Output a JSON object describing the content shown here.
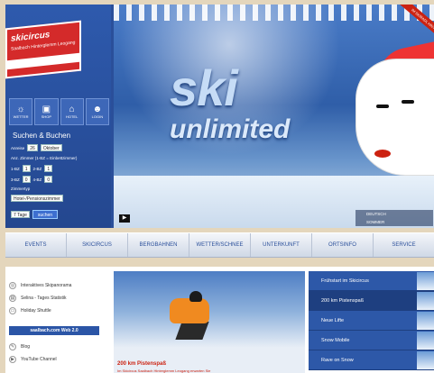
{
  "logo": {
    "name": "skicircus",
    "subtitle": "Saalbach Hinterglemm Leogang"
  },
  "nav_icons": [
    {
      "icon": "weather-icon",
      "label": "WETTER"
    },
    {
      "icon": "bag-icon",
      "label": "SHOP"
    },
    {
      "icon": "hotel-icon",
      "label": "HOTEL"
    },
    {
      "icon": "person-icon",
      "label": "LOGIN"
    }
  ],
  "search": {
    "title": "Suchen & Buchen",
    "arrival_label": "Anreise",
    "arrival_day": "26",
    "arrival_month": "Oktober",
    "rooms_label": "Anz. Zimmer (1-BZ = Einbettzimmer)",
    "room_1bz_label": "1-BZ",
    "room_1bz_value": "1",
    "room_2bz_label": "2-BZ",
    "room_2bz_value": "1",
    "room_3bz_label": "3-BZ",
    "room_3bz_value": "0",
    "room_4bz_label": "4-BZ",
    "room_4bz_value": "0",
    "category_label": "Zimmertyp",
    "category_value": "Hotel-/Pensionszimmer",
    "nights_value": "7 Tage",
    "submit_label": "suchen"
  },
  "hero": {
    "title": "ski",
    "subtitle": "unlimited",
    "badge": "IM SKIRADL HINTERGLEMM"
  },
  "languages": [
    "DEUTSCH",
    "SOMMER"
  ],
  "navbar": [
    "EVENTS",
    "SKICIRCUS",
    "BERGBAHNEN",
    "WETTER/SCHNEE",
    "UNTERKUNFT",
    "ORTSINFO",
    "SERVICE"
  ],
  "quicklinks": [
    {
      "icon": "panorama-icon",
      "label": "Interaktives Skipanorama"
    },
    {
      "icon": "ticket-icon",
      "label": "Selina - Tages Statistik"
    },
    {
      "icon": "shuttle-icon",
      "label": "Holiday Shuttle"
    }
  ],
  "web20_label": "saalbach.com Web 2.0",
  "quicklinks2": [
    {
      "icon": "blog-icon",
      "label": "Blog"
    },
    {
      "icon": "youtube-icon",
      "label": "YouTube Channel"
    }
  ],
  "feature": {
    "title": "200 km Pistenspaß",
    "text": "Im Skicircus Saalbach Hinterglemm Leogang erwarten Sie"
  },
  "sidelist": [
    {
      "label": "Frühstart im Skicircus",
      "active": false
    },
    {
      "label": "200 km Pistenspaß",
      "active": true
    },
    {
      "label": "Neue Lifte",
      "active": false
    },
    {
      "label": "Snow Mobile",
      "active": false
    },
    {
      "label": "Rave on Snow",
      "active": false
    }
  ],
  "colors": {
    "brand_blue": "#2a4f9a",
    "accent_red": "#cc2222",
    "background": "#e4d6bc"
  }
}
